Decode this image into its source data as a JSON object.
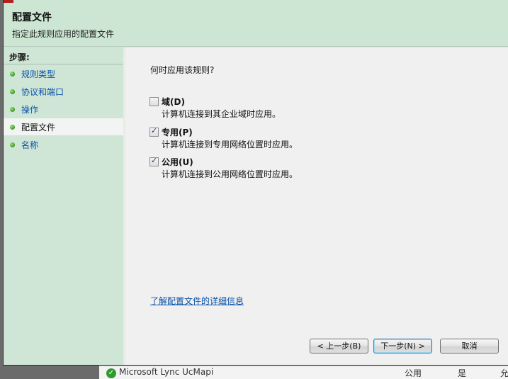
{
  "window": {
    "title": "配置文件",
    "subtitle": "指定此规则应用的配置文件"
  },
  "sidebar": {
    "heading": "步骤:",
    "items": [
      {
        "label": "规则类型",
        "active": false
      },
      {
        "label": "协议和端口",
        "active": false
      },
      {
        "label": "操作",
        "active": false
      },
      {
        "label": "配置文件",
        "active": true
      },
      {
        "label": "名称",
        "active": false
      }
    ]
  },
  "main": {
    "question": "何时应用该规则?",
    "options": [
      {
        "label": "域(D)",
        "description": "计算机连接到其企业域时应用。",
        "checked": false
      },
      {
        "label": "专用(P)",
        "description": "计算机连接到专用网络位置时应用。",
        "checked": true
      },
      {
        "label": "公用(U)",
        "description": "计算机连接到公用网络位置时应用。",
        "checked": true
      }
    ],
    "learn_more": "了解配置文件的详细信息"
  },
  "buttons": {
    "back": "< 上一步(B)",
    "next": "下一步(N) >",
    "cancel": "取消"
  },
  "background_row": {
    "name": "Microsoft Lync UcMapi",
    "profile": "公用",
    "enabled": "是",
    "extra": "允"
  },
  "colors": {
    "header_bg": "#cce6d3",
    "sidebar_bg": "#cfe5d6",
    "link": "#0a53a8",
    "main_bg": "#f0f0f0"
  }
}
